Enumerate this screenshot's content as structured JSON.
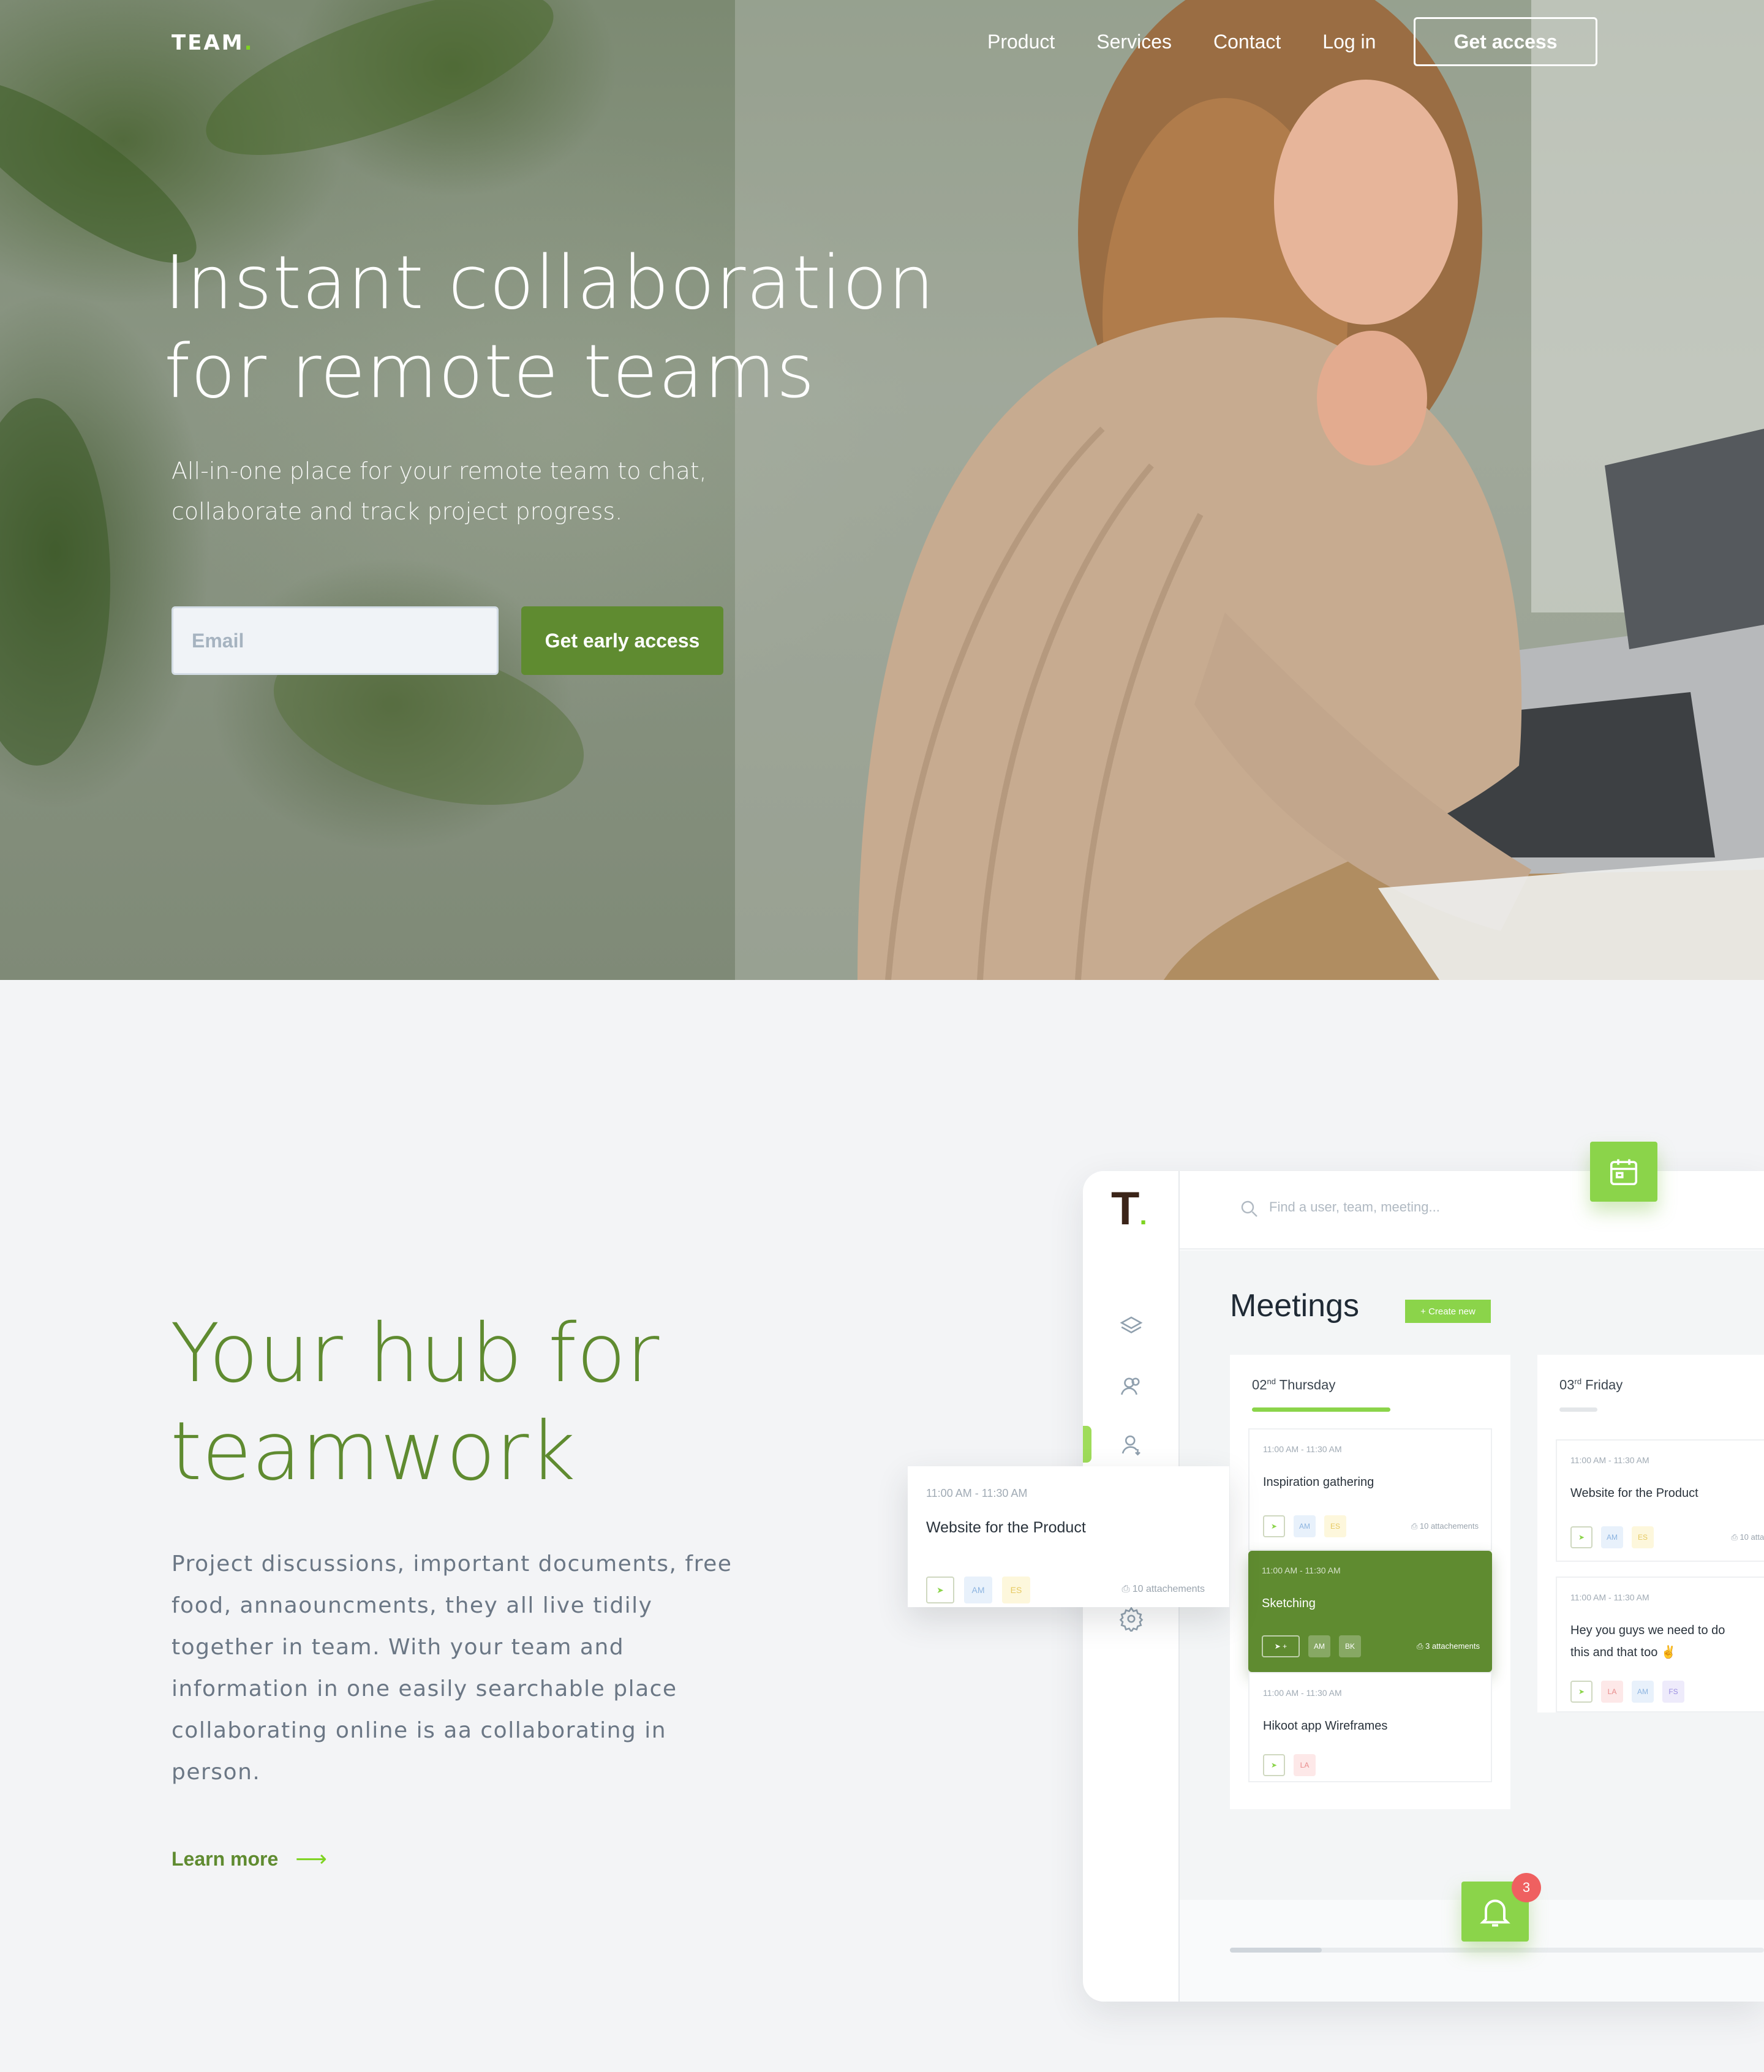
{
  "nav": {
    "logo": "TEAM",
    "logo_dot": ".",
    "links": [
      "Product",
      "Services",
      "Contact",
      "Log in"
    ],
    "cta": "Get access"
  },
  "hero": {
    "title_line1": "Instant collaboration",
    "title_line2": "for remote teams",
    "subtitle_line1": "All-in-one place for your remote team to chat,",
    "subtitle_line2": "collaborate and track project progress.",
    "email_placeholder": "Email",
    "cta": "Get early access"
  },
  "hub": {
    "title_line1": "Your hub for",
    "title_line2": "teamwork",
    "body": "Project discussions, important documents, free food, annaouncments, they all live tidily together in team. With your team and information in one easily searchable place collaborating online is aa collaborating in person.",
    "learn_more": "Learn more",
    "arrow": "⟶"
  },
  "app": {
    "logo": "T",
    "logo_dot": ".",
    "search_placeholder": "Find a user, team, meeting...",
    "meetings_title": "Meetings",
    "create_new": "+ Create new",
    "notification_count": "3",
    "days": [
      {
        "num": "02",
        "suffix": "nd",
        "name": "Thursday",
        "meetings": [
          {
            "time": "11:00 AM - 11:30 AM",
            "title": "Inspiration gathering",
            "tags": [
              "AM",
              "ES"
            ],
            "attach": "10 attachements"
          },
          {
            "time": "11:00 AM - 11:30 AM",
            "title": "Sketching",
            "tags": [
              "AM",
              "BK"
            ],
            "attach": "3 attachements"
          },
          {
            "time": "11:00 AM - 11:30 AM",
            "title": "Hikoot app Wireframes",
            "tags": [
              "LA"
            ],
            "attach": ""
          }
        ]
      },
      {
        "num": "03",
        "suffix": "rd",
        "name": "Friday",
        "meetings": [
          {
            "time": "11:00 AM - 11:30 AM",
            "title": "Website for the Product",
            "tags": [
              "AM",
              "ES"
            ],
            "attach": "10 attachem"
          },
          {
            "time": "11:00 AM - 11:30 AM",
            "title": "Hey you guys we need to do this and that too ✌",
            "tags": [
              "LA",
              "AM",
              "FS"
            ],
            "attach": ""
          }
        ]
      }
    ],
    "float_card": {
      "time": "11:00 AM - 11:30 AM",
      "title": "Website for the Product",
      "tags": [
        "AM",
        "ES"
      ],
      "attach": "10 attachements"
    }
  },
  "colors": {
    "accent": "#5f8b30",
    "accent_light": "#8bd44a",
    "logo_dot": "#7ed321",
    "badge_red": "#ef6060"
  }
}
